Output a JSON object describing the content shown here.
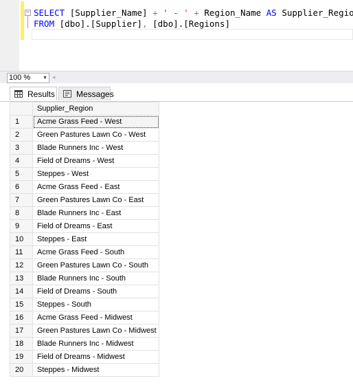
{
  "editor": {
    "line1": {
      "keyword_select": "SELECT",
      "col1": "[Supplier_Name]",
      "plus1": "+",
      "string": "' - '",
      "plus2": "+",
      "col2": "Region_Name",
      "keyword_as": "AS",
      "alias": "Supplier_Region"
    },
    "line2": {
      "keyword_from": "FROM",
      "table1": "[dbo].[Supplier]",
      "comma": ",",
      "table2": "[dbo].[Regions]"
    },
    "collapse_symbol": "−"
  },
  "zoom": {
    "value": "100 %",
    "arrow": "▼",
    "scroll_left": "◂"
  },
  "tabs": [
    {
      "label": "Results"
    },
    {
      "label": "Messages"
    }
  ],
  "results": {
    "columns": [
      "Supplier_Region"
    ],
    "rows": [
      {
        "n": "1",
        "v": "Acme Grass Feed - West"
      },
      {
        "n": "2",
        "v": "Green Pastures Lawn Co - West"
      },
      {
        "n": "3",
        "v": "Blade Runners Inc - West"
      },
      {
        "n": "4",
        "v": "Field of Dreams - West"
      },
      {
        "n": "5",
        "v": "Steppes - West"
      },
      {
        "n": "6",
        "v": "Acme Grass Feed - East"
      },
      {
        "n": "7",
        "v": "Green Pastures Lawn Co - East"
      },
      {
        "n": "8",
        "v": "Blade Runners Inc - East"
      },
      {
        "n": "9",
        "v": "Field of Dreams - East"
      },
      {
        "n": "10",
        "v": "Steppes - East"
      },
      {
        "n": "11",
        "v": "Acme Grass Feed - South"
      },
      {
        "n": "12",
        "v": "Green Pastures Lawn Co - South"
      },
      {
        "n": "13",
        "v": "Blade Runners Inc - South"
      },
      {
        "n": "14",
        "v": "Field of Dreams - South"
      },
      {
        "n": "15",
        "v": "Steppes - South"
      },
      {
        "n": "16",
        "v": "Acme Grass Feed - Midwest"
      },
      {
        "n": "17",
        "v": "Green Pastures Lawn Co - Midwest"
      },
      {
        "n": "18",
        "v": "Blade Runners Inc - Midwest"
      },
      {
        "n": "19",
        "v": "Field of Dreams - Midwest"
      },
      {
        "n": "20",
        "v": "Steppes - Midwest"
      }
    ]
  },
  "colors": {
    "keyword": "#0000ff",
    "string": "#ff0000",
    "operator": "#808080",
    "changebar": "#ffee62"
  }
}
